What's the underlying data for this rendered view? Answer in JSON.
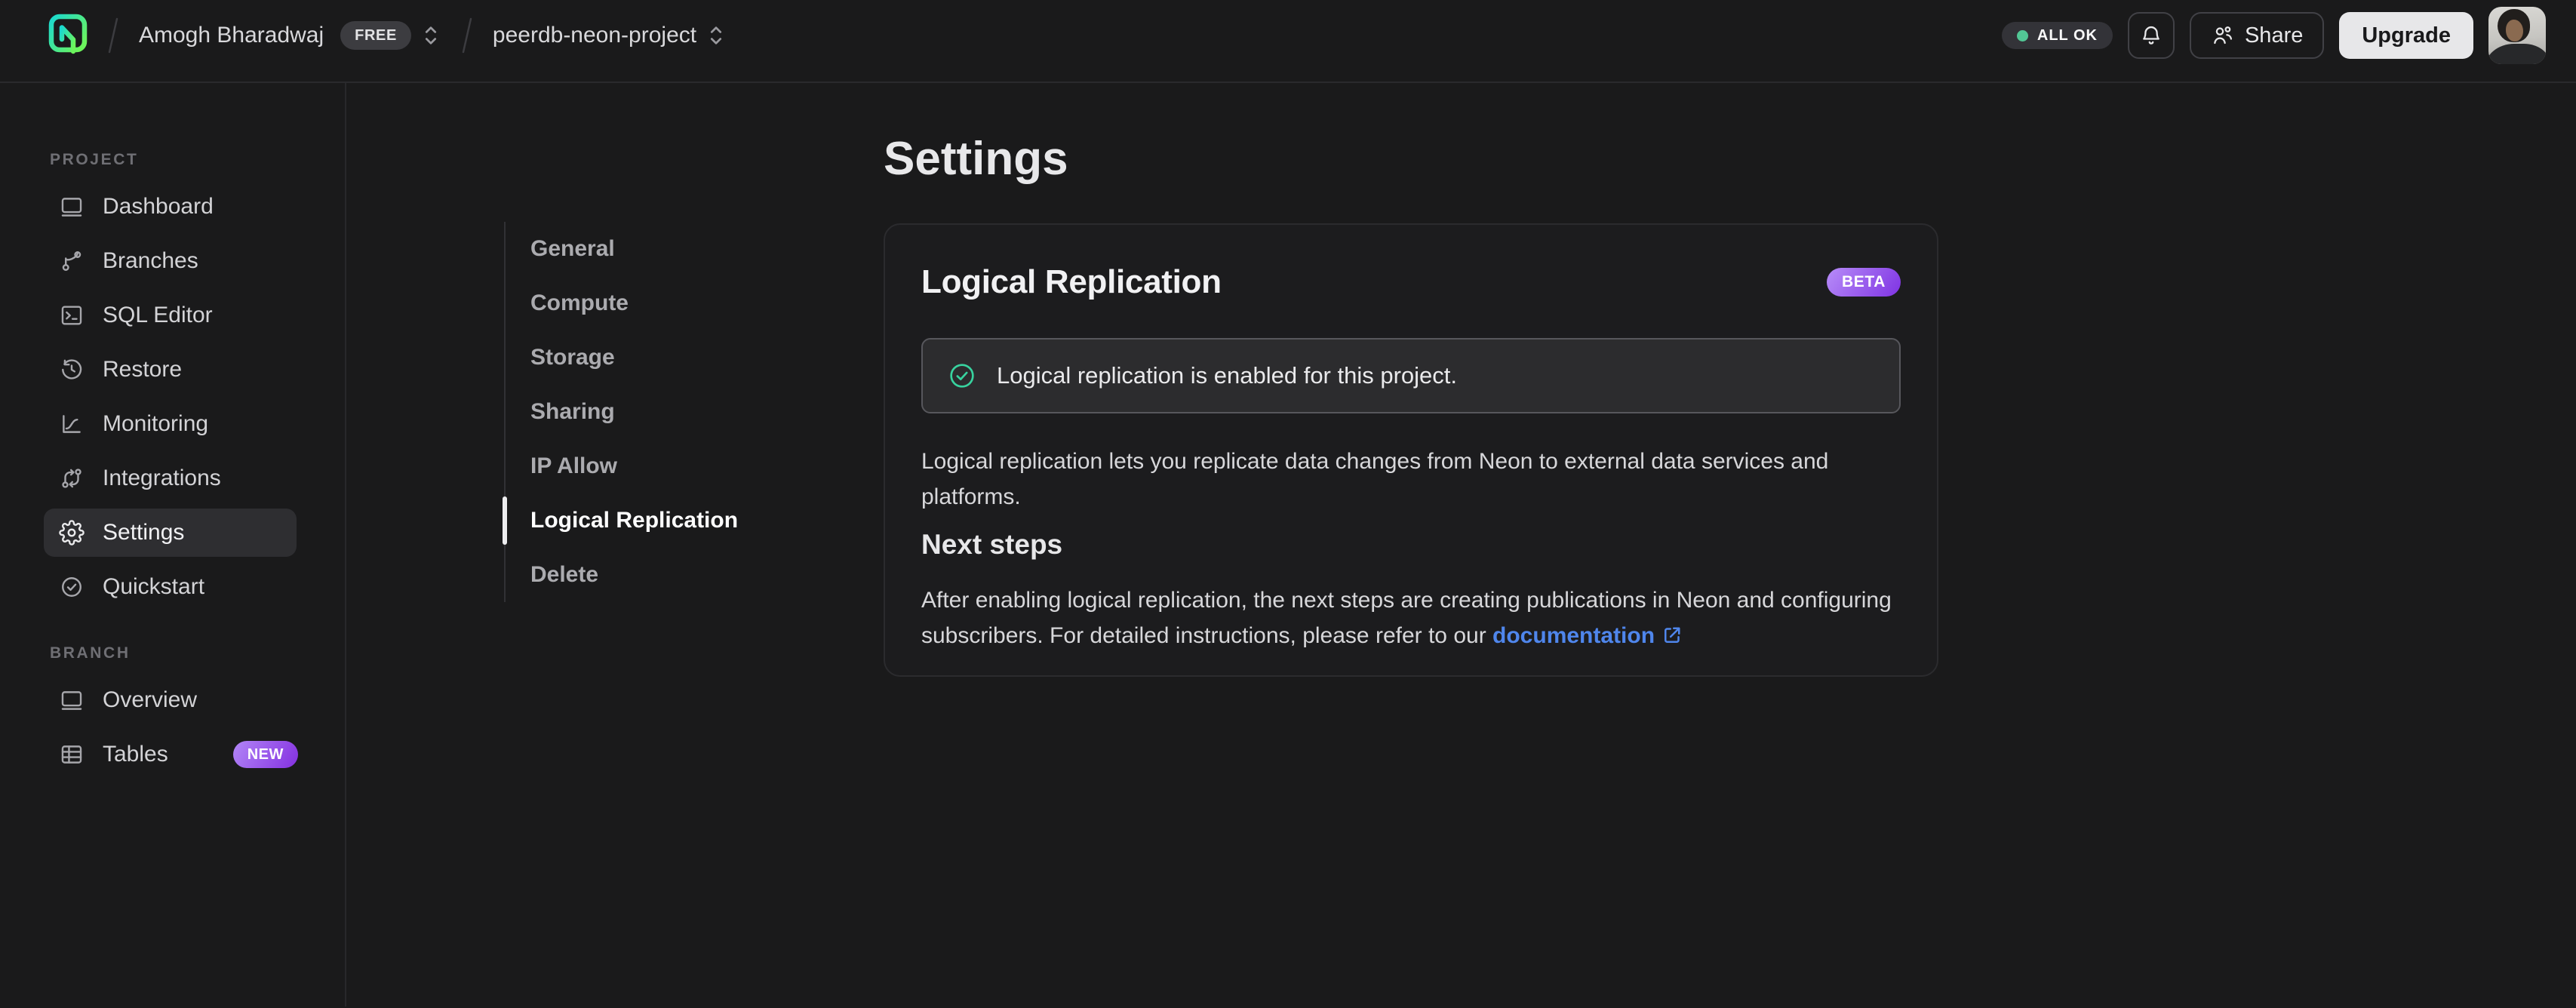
{
  "topbar": {
    "breadcrumb": {
      "org": "Amogh Bharadwaj",
      "org_badge": "FREE",
      "project": "peerdb-neon-project"
    },
    "status_label": "ALL OK",
    "share_label": "Share",
    "upgrade_label": "Upgrade"
  },
  "sidebar": {
    "sections": [
      {
        "label": "PROJECT",
        "items": [
          {
            "label": "Dashboard",
            "icon": "dashboard-icon"
          },
          {
            "label": "Branches",
            "icon": "branches-icon"
          },
          {
            "label": "SQL Editor",
            "icon": "sql-editor-icon"
          },
          {
            "label": "Restore",
            "icon": "restore-icon"
          },
          {
            "label": "Monitoring",
            "icon": "monitoring-icon"
          },
          {
            "label": "Integrations",
            "icon": "integrations-icon"
          },
          {
            "label": "Settings",
            "icon": "gear-icon",
            "active": true
          },
          {
            "label": "Quickstart",
            "icon": "check-circle-icon"
          }
        ]
      },
      {
        "label": "BRANCH",
        "items": [
          {
            "label": "Overview",
            "icon": "overview-icon"
          },
          {
            "label": "Tables",
            "icon": "tables-icon",
            "badge": "NEW"
          }
        ]
      }
    ]
  },
  "settings_nav": {
    "items": [
      {
        "label": "General"
      },
      {
        "label": "Compute"
      },
      {
        "label": "Storage"
      },
      {
        "label": "Sharing"
      },
      {
        "label": "IP Allow"
      },
      {
        "label": "Logical Replication",
        "active": true
      },
      {
        "label": "Delete"
      }
    ]
  },
  "main": {
    "page_title": "Settings",
    "card": {
      "title": "Logical Replication",
      "badge": "BETA",
      "alert_text": "Logical replication is enabled for this project.",
      "description": "Logical replication lets you replicate data changes from Neon to external data services and platforms.",
      "next_steps_title": "Next steps",
      "next_steps_text": "After enabling logical replication, the next steps are creating publications in Neon and configuring subscribers. For detailed instructions, please refer to our ",
      "doc_link_label": "documentation"
    }
  },
  "colors": {
    "background": "#1a1a1b",
    "accent_green": "#38d39f",
    "status_dot_green": "#52c795",
    "link_blue": "#4f86ec",
    "badge_purple_start": "#b286f7",
    "badge_purple_end": "#8430e0",
    "brand_cyan": "#1ad9cf",
    "brand_green": "#6cf45c",
    "upgrade_bg": "#e7e7e9"
  }
}
